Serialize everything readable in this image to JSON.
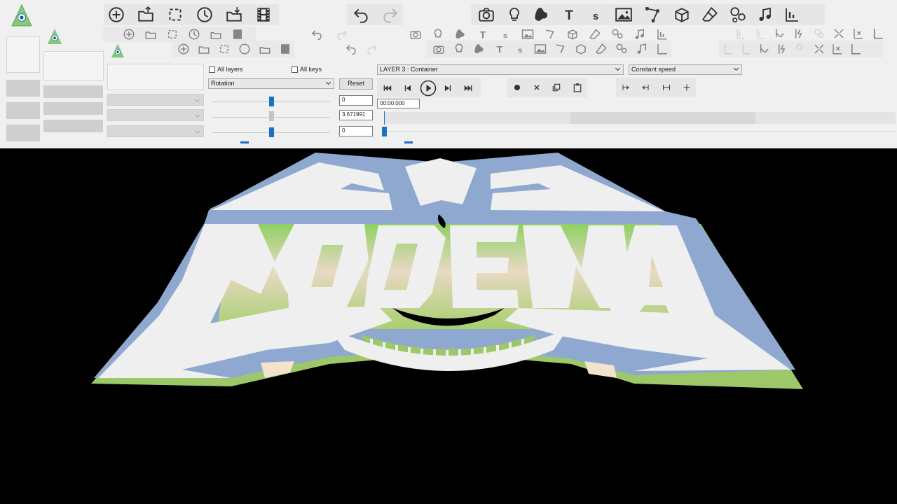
{
  "toolbar": {
    "row1_icons": [
      "add-icon",
      "open-icon",
      "crop-icon",
      "clock-icon",
      "import-icon",
      "film-icon"
    ],
    "history_icons": [
      "undo-icon",
      "redo-icon"
    ],
    "insert_icons": [
      "camera-icon",
      "lightbulb-icon",
      "blob-icon",
      "text-icon",
      "s-text-icon",
      "image-icon",
      "path-icon",
      "cube-icon",
      "eraser-icon",
      "particles-icon",
      "music-icon",
      "align-icon"
    ],
    "right_icons": [
      "anchor-icon",
      "anchor-alt-icon",
      "link-icon",
      "bolt-icon",
      "group-icon",
      "collapse-icon",
      "remove-icon",
      "align-bottom-icon"
    ],
    "text_glyph": "T",
    "s_glyph": "s"
  },
  "panel": {
    "all_layers_label": "All layers",
    "all_keys_label": "All keys",
    "property_value": "Rotation",
    "reset_label": "Reset",
    "field_top": "0",
    "field_mid": "3.671991",
    "field_bottom": "0"
  },
  "timeline": {
    "layer_value": "LAYER 3 : Container",
    "speed_value": "Constant speed",
    "time_value": "00:00.000",
    "transport_icons": [
      "skip-start-icon",
      "step-back-icon",
      "play-icon",
      "step-forward-icon",
      "skip-end-icon"
    ],
    "key_icons": [
      "record-icon",
      "delete-key-icon",
      "copy-key-icon",
      "paste-key-icon"
    ],
    "align_icons": [
      "align-left-icon",
      "align-right-icon",
      "spread-icon",
      "center-icon"
    ]
  },
  "canvas": {
    "background": "#000000",
    "logo_face": "#efefef",
    "logo_rim": "#8fa8d0",
    "logo_side": "#9cc86a"
  }
}
